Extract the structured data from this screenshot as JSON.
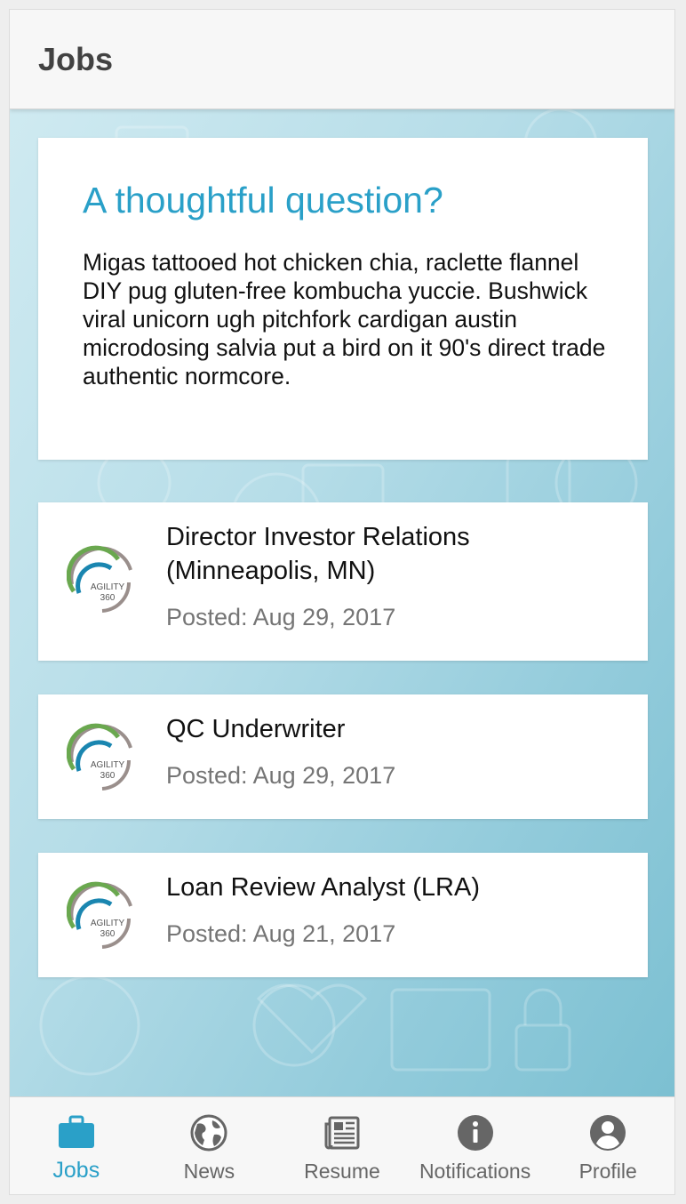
{
  "header": {
    "title": "Jobs"
  },
  "intro": {
    "title": "A thoughtful question?",
    "body": "Migas tattooed hot chicken chia, raclette flannel DIY pug gluten-free kombucha yuccie. Bushwick viral unicorn ugh pitchfork cardigan austin microdosing salvia put a bird on it 90's direct trade authentic normcore."
  },
  "logo": {
    "line1": "AGILITY",
    "line2": "360"
  },
  "jobs": [
    {
      "title": "Director Investor Relations (Minneapolis, MN)",
      "posted": "Posted: Aug 29, 2017"
    },
    {
      "title": "QC Underwriter",
      "posted": "Posted: Aug 29, 2017"
    },
    {
      "title": "Loan Review Analyst (LRA)",
      "posted": "Posted: Aug 21, 2017"
    }
  ],
  "tabs": [
    {
      "label": "Jobs",
      "icon": "briefcase-icon",
      "active": true
    },
    {
      "label": "News",
      "icon": "globe-icon",
      "active": false
    },
    {
      "label": "Resume",
      "icon": "newspaper-icon",
      "active": false
    },
    {
      "label": "Notifications",
      "icon": "info-icon",
      "active": false
    },
    {
      "label": "Profile",
      "icon": "user-circle-icon",
      "active": false
    }
  ],
  "colors": {
    "accent": "#2aa0c8",
    "icon_inactive": "#666666",
    "logo_green": "#6aa84f",
    "logo_blue": "#1a86b0",
    "logo_gray": "#9a8f8c"
  }
}
